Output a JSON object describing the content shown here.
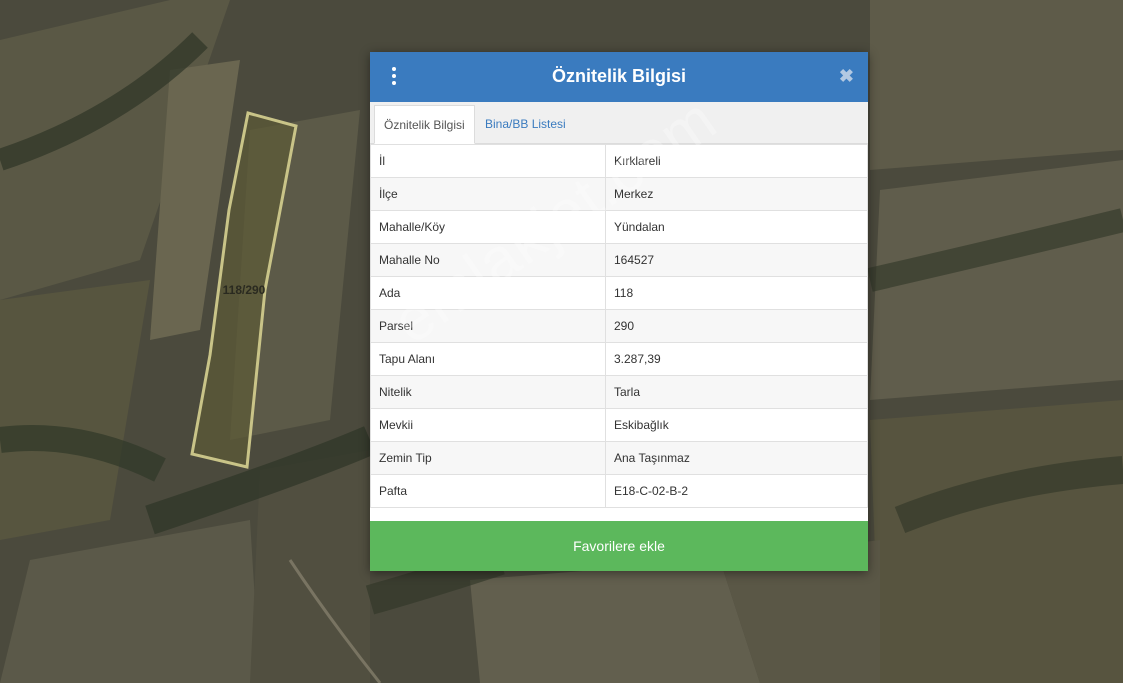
{
  "map": {
    "parcel_label": "118/290",
    "watermark": "emlakjet.com"
  },
  "modal": {
    "title": "Öznitelik Bilgisi",
    "menu_icon": "vertical-dots-icon",
    "close_icon": "close-icon",
    "tabs": [
      {
        "label": "Öznitelik Bilgisi",
        "active": true
      },
      {
        "label": "Bina/BB Listesi",
        "active": false
      }
    ],
    "rows": [
      {
        "key": "İl",
        "value": "Kırklareli"
      },
      {
        "key": "İlçe",
        "value": "Merkez"
      },
      {
        "key": "Mahalle/Köy",
        "value": "Yündalan"
      },
      {
        "key": "Mahalle No",
        "value": "164527"
      },
      {
        "key": "Ada",
        "value": "118"
      },
      {
        "key": "Parsel",
        "value": "290"
      },
      {
        "key": "Tapu Alanı",
        "value": "3.287,39"
      },
      {
        "key": "Nitelik",
        "value": "Tarla"
      },
      {
        "key": "Mevkii",
        "value": "Eskibağlık"
      },
      {
        "key": "Zemin Tip",
        "value": "Ana Taşınmaz"
      },
      {
        "key": "Pafta",
        "value": "E18-C-02-B-2"
      }
    ],
    "favorite_button": "Favorilere ekle"
  },
  "colors": {
    "header": "#3a7bbf",
    "favorite": "#5cb85c",
    "parcel_outline": "#c9c488"
  }
}
